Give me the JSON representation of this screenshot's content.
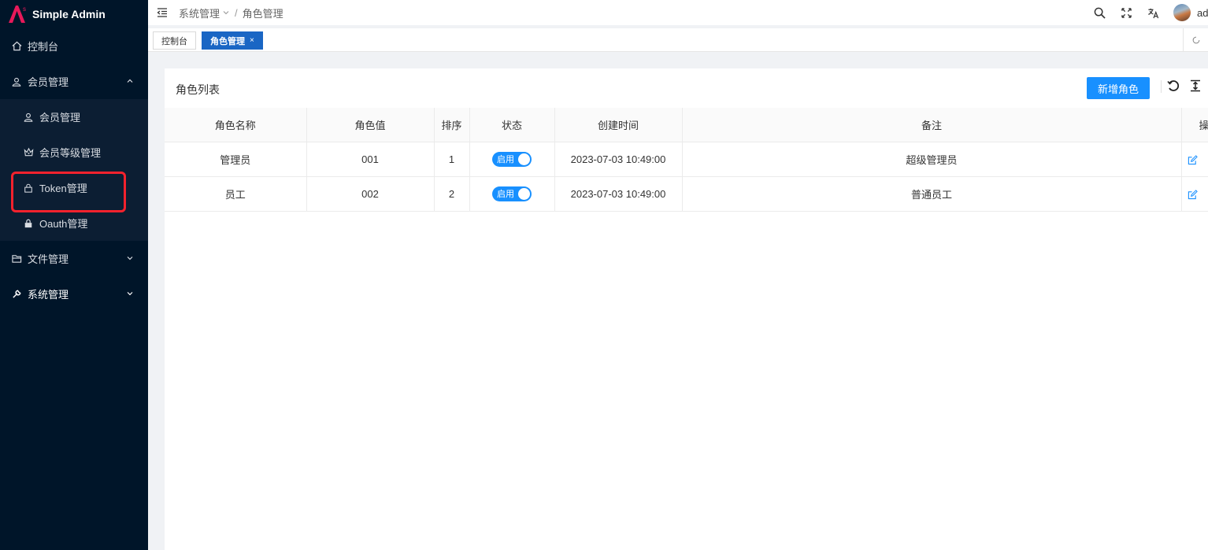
{
  "app": {
    "title": "Simple Admin",
    "accent": "#1890ff",
    "sidebar_bg": "#001529"
  },
  "sidebar": {
    "items": [
      {
        "label": "控制台",
        "icon": "home-icon"
      },
      {
        "label": "会员管理",
        "icon": "user-icon",
        "expanded": true,
        "children": [
          {
            "label": "会员管理",
            "icon": "user-icon"
          },
          {
            "label": "会员等级管理",
            "icon": "crown-icon"
          },
          {
            "label": "Token管理",
            "icon": "lock-icon"
          },
          {
            "label": "Oauth管理",
            "icon": "lock-filled-icon"
          }
        ]
      },
      {
        "label": "文件管理",
        "icon": "folder-icon"
      },
      {
        "label": "系统管理",
        "icon": "wrench-icon"
      }
    ]
  },
  "header": {
    "breadcrumb": [
      "系统管理",
      "角色管理"
    ],
    "username": "admin"
  },
  "tabs": [
    {
      "label": "控制台",
      "active": false
    },
    {
      "label": "角色管理",
      "active": true,
      "close": "×"
    }
  ],
  "card": {
    "title": "角色列表",
    "add_button": "新增角色"
  },
  "table": {
    "columns": [
      "角色名称",
      "角色值",
      "排序",
      "状态",
      "创建时间",
      "备注",
      "操作"
    ],
    "rows": [
      {
        "name": "管理员",
        "value": "001",
        "sort": "1",
        "status": "启用",
        "created": "2023-07-03 10:49:00",
        "remark": "超级管理员"
      },
      {
        "name": "员工",
        "value": "002",
        "sort": "2",
        "status": "启用",
        "created": "2023-07-03 10:49:00",
        "remark": "普通员工"
      }
    ]
  }
}
